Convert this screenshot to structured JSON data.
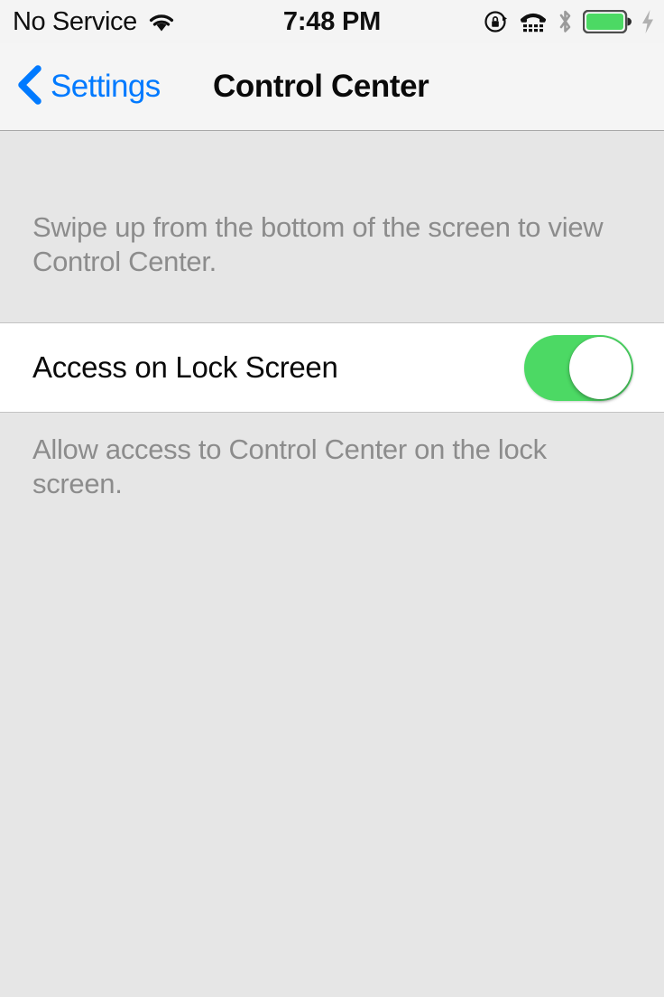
{
  "status_bar": {
    "carrier": "No Service",
    "wifi_icon": "wifi-icon",
    "time": "7:48 PM",
    "right_icons": [
      {
        "name": "rotation-lock-icon",
        "label": "Portrait Orientation Lock"
      },
      {
        "name": "tty-icon",
        "label": "TTY"
      },
      {
        "name": "bluetooth-icon",
        "label": "Bluetooth"
      },
      {
        "name": "battery-icon",
        "label": "Battery Full"
      },
      {
        "name": "charging-bolt-icon",
        "label": "Charging"
      }
    ],
    "background_color": "#f4f4f4",
    "bluetooth_color": "#9a9a9a",
    "battery_fill_color": "#4cd964"
  },
  "nav_bar": {
    "back_label": "Settings",
    "back_icon": "chevron-left-icon",
    "title": "Control Center",
    "accent_color": "#007aff"
  },
  "content": {
    "section_header": "Swipe up from the bottom of the screen to view Control Center.",
    "rows": [
      {
        "label": "Access on Lock Screen",
        "toggle_state": "on",
        "toggle_on_color": "#4cd964"
      }
    ],
    "section_footer": "Allow access to Control Center on the lock screen.",
    "background_color": "#e6e6e6",
    "footer_text_color": "#8c8c8c"
  }
}
